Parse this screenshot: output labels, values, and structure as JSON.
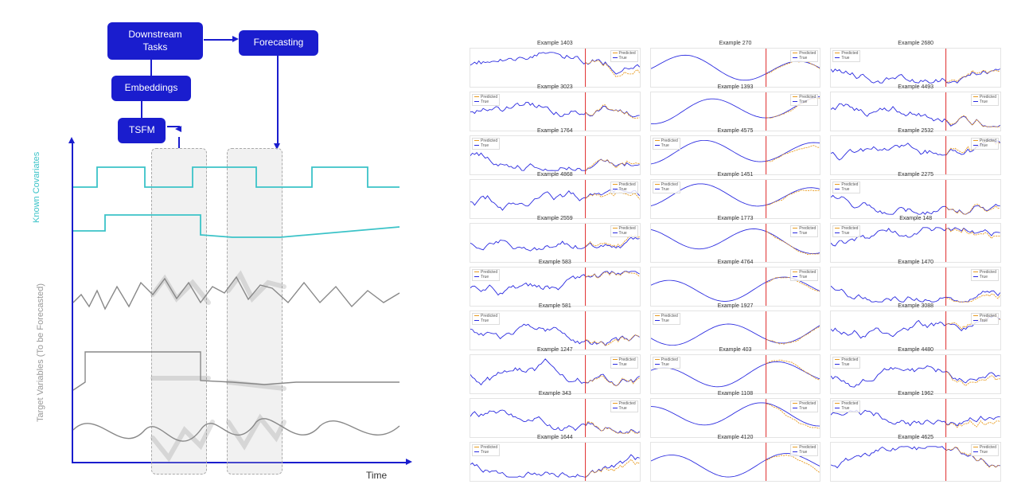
{
  "flow": {
    "downstream": "Downstream Tasks",
    "forecasting": "Forecasting",
    "embeddings": "Embeddings",
    "tsfm": "TSFM"
  },
  "axes": {
    "x_label": "Time",
    "y_label_covariates": "Known Covariates",
    "y_label_target": "Target Variables (To be Forecasted)"
  },
  "chart_data": {
    "type": "diagram",
    "description": "Left: schematic of a time-series foundation model (TSFM) producing embeddings used for downstream tasks and forecasting, with two highlighted windows over known covariates and target variables plotted against Time. Right: 3×10 grid of small forecasting example panels each showing a true (blue) series, a predicted (orange dashed) continuation after a vertical red cutoff line.",
    "right_grid": {
      "cols": 3,
      "rows": 10
    }
  },
  "legend": {
    "predicted": "Predicted",
    "true": "True"
  },
  "mini_charts": [
    {
      "id": "Example 1403",
      "seed": 1403,
      "style": "noisy"
    },
    {
      "id": "Example 270",
      "seed": 270,
      "style": "smooth"
    },
    {
      "id": "Example 2680",
      "seed": 2680,
      "style": "noisy"
    },
    {
      "id": "Example 3023",
      "seed": 3023,
      "style": "noisy"
    },
    {
      "id": "Example 1393",
      "seed": 1393,
      "style": "smooth"
    },
    {
      "id": "Example 4493",
      "seed": 4493,
      "style": "noisy"
    },
    {
      "id": "Example 1764",
      "seed": 1764,
      "style": "noisy"
    },
    {
      "id": "Example 4575",
      "seed": 4575,
      "style": "smooth"
    },
    {
      "id": "Example 2532",
      "seed": 2532,
      "style": "noisy"
    },
    {
      "id": "Example 4868",
      "seed": 4868,
      "style": "noisy"
    },
    {
      "id": "Example 1451",
      "seed": 1451,
      "style": "smooth"
    },
    {
      "id": "Example 2275",
      "seed": 2275,
      "style": "noisy"
    },
    {
      "id": "Example 2559",
      "seed": 2559,
      "style": "noisy"
    },
    {
      "id": "Example 1773",
      "seed": 1773,
      "style": "smooth"
    },
    {
      "id": "Example 148",
      "seed": 148,
      "style": "noisy"
    },
    {
      "id": "Example 583",
      "seed": 583,
      "style": "noisy"
    },
    {
      "id": "Example 4764",
      "seed": 4764,
      "style": "smooth"
    },
    {
      "id": "Example 1470",
      "seed": 1470,
      "style": "noisy"
    },
    {
      "id": "Example 581",
      "seed": 581,
      "style": "noisy"
    },
    {
      "id": "Example 1927",
      "seed": 1927,
      "style": "smooth"
    },
    {
      "id": "Example 3088",
      "seed": 3088,
      "style": "noisy"
    },
    {
      "id": "Example 1247",
      "seed": 1247,
      "style": "noisy"
    },
    {
      "id": "Example 403",
      "seed": 403,
      "style": "smooth"
    },
    {
      "id": "Example 4480",
      "seed": 4480,
      "style": "noisy"
    },
    {
      "id": "Example 343",
      "seed": 343,
      "style": "noisy"
    },
    {
      "id": "Example 1108",
      "seed": 1108,
      "style": "smooth"
    },
    {
      "id": "Example 1962",
      "seed": 1962,
      "style": "noisy"
    },
    {
      "id": "Example 1644",
      "seed": 1644,
      "style": "noisy"
    },
    {
      "id": "Example 4120",
      "seed": 4120,
      "style": "smooth"
    },
    {
      "id": "Example 4625",
      "seed": 4625,
      "style": "noisy"
    }
  ]
}
